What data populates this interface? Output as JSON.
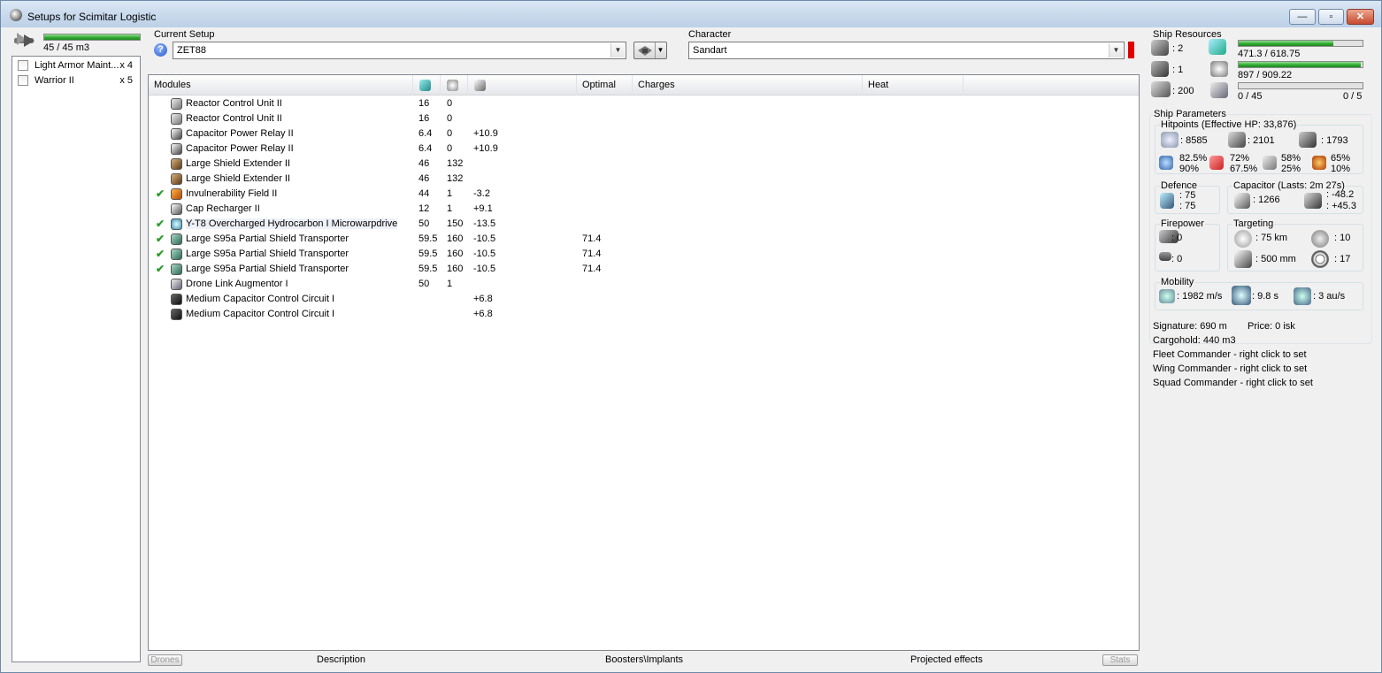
{
  "window": {
    "title": "Setups for Scimitar Logistic",
    "minimize": "—",
    "maximize": "▫",
    "close": "✕"
  },
  "drone_bay": {
    "capacity_text": "45 / 45 m3",
    "capacity_fraction": 1.0,
    "items": [
      {
        "label": "Light Armor Maint...",
        "count": "x 4"
      },
      {
        "label": "Warrior II",
        "count": "x 5"
      }
    ]
  },
  "setup": {
    "group_label": "Current Setup",
    "selected": "ZET88",
    "help_icon": "question-icon"
  },
  "character": {
    "group_label": "Character",
    "selected": "Sandart"
  },
  "modules": {
    "headers": {
      "modules": "Modules",
      "cpu_icon": "cpu-icon",
      "power_icon": "powergrid-icon",
      "cap_icon": "capacitor-icon",
      "optimal": "Optimal",
      "charges": "Charges",
      "heat": "Heat"
    },
    "rows": [
      {
        "active": false,
        "icon": "reactor-icon",
        "name": "Reactor Control Unit II",
        "cpu": "16",
        "pg": "0",
        "cap": "",
        "optimal": ""
      },
      {
        "active": false,
        "icon": "reactor-icon",
        "name": "Reactor Control Unit II",
        "cpu": "16",
        "pg": "0",
        "cap": "",
        "optimal": ""
      },
      {
        "active": false,
        "icon": "cap-relay-icon",
        "name": "Capacitor Power Relay II",
        "cpu": "6.4",
        "pg": "0",
        "cap": "+10.9",
        "optimal": ""
      },
      {
        "active": false,
        "icon": "cap-relay-icon",
        "name": "Capacitor Power Relay II",
        "cpu": "6.4",
        "pg": "0",
        "cap": "+10.9",
        "optimal": ""
      },
      {
        "active": false,
        "icon": "shield-extender-icon",
        "name": "Large Shield Extender II",
        "cpu": "46",
        "pg": "132",
        "cap": "",
        "optimal": ""
      },
      {
        "active": false,
        "icon": "shield-extender-icon",
        "name": "Large Shield Extender II",
        "cpu": "46",
        "pg": "132",
        "cap": "",
        "optimal": ""
      },
      {
        "active": true,
        "icon": "invuln-field-icon",
        "name": "Invulnerability Field II",
        "cpu": "44",
        "pg": "1",
        "cap": "-3.2",
        "optimal": ""
      },
      {
        "active": false,
        "icon": "cap-recharger-icon",
        "name": "Cap Recharger II",
        "cpu": "12",
        "pg": "1",
        "cap": "+9.1",
        "optimal": ""
      },
      {
        "active": true,
        "icon": "microwarpdrive-icon",
        "name": "Y-T8 Overcharged Hydrocarbon I Microwarpdrive",
        "cpu": "50",
        "pg": "150",
        "cap": "-13.5",
        "optimal": ""
      },
      {
        "active": true,
        "icon": "shield-transporter-icon",
        "name": "Large S95a Partial Shield Transporter",
        "cpu": "59.5",
        "pg": "160",
        "cap": "-10.5",
        "optimal": "71.4"
      },
      {
        "active": true,
        "icon": "shield-transporter-icon",
        "name": "Large S95a Partial Shield Transporter",
        "cpu": "59.5",
        "pg": "160",
        "cap": "-10.5",
        "optimal": "71.4"
      },
      {
        "active": true,
        "icon": "shield-transporter-icon",
        "name": "Large S95a Partial Shield Transporter",
        "cpu": "59.5",
        "pg": "160",
        "cap": "-10.5",
        "optimal": "71.4"
      },
      {
        "active": false,
        "icon": "drone-link-icon",
        "name": "Drone Link Augmentor I",
        "cpu": "50",
        "pg": "1",
        "cap": "",
        "optimal": ""
      },
      {
        "active": false,
        "icon": "rig-icon",
        "name": "Medium Capacitor Control Circuit I",
        "cpu": "",
        "pg": "",
        "cap": "+6.8",
        "optimal": ""
      },
      {
        "active": false,
        "icon": "rig-icon",
        "name": "Medium Capacitor Control Circuit I",
        "cpu": "",
        "pg": "",
        "cap": "+6.8",
        "optimal": ""
      }
    ],
    "check_glyph": "✔"
  },
  "bottom_tabs": {
    "drones": "Drones",
    "description": "Description",
    "boosters": "Boosters\\Implants",
    "projected": "Projected effects",
    "stats": "Stats"
  },
  "ship_resources": {
    "label": "Ship Resources",
    "turret_slots": ": 2",
    "launcher_slots": ": 1",
    "calibration": ": 200",
    "cpu_text": "471.3 / 618.75",
    "cpu_fraction": 0.762,
    "power_text": "897 / 909.22",
    "power_fraction": 0.987,
    "drone_bandwidth_text": "0 / 45",
    "drone_count_text": "0 / 5",
    "drone_fraction": 0.0
  },
  "ship_parameters": {
    "label": "Ship Parameters",
    "hitpoints_label": "Hitpoints (Effective HP: 33,876)",
    "shield_hp": ": 8585",
    "armor_hp": ": 2101",
    "structure_hp": ": 1793",
    "resists": [
      {
        "icon": "em-resist-icon",
        "shield": "82.5%",
        "armor": "90%"
      },
      {
        "icon": "thermal-resist-icon",
        "shield": "72%",
        "armor": "67.5%"
      },
      {
        "icon": "kinetic-resist-icon",
        "shield": "58%",
        "armor": "25%"
      },
      {
        "icon": "explosive-resist-icon",
        "shield": "65%",
        "armor": "10%"
      }
    ],
    "defence_label": "Defence",
    "defence_a": ": 75",
    "defence_b": ": 75",
    "capacitor_label": "Capacitor (Lasts: 2m 27s)",
    "capacitor_amount": ": 1266",
    "cap_use": ": -48.2",
    "cap_regen": ": +45.3",
    "firepower_label": "Firepower",
    "firepower_turrets": ": 0",
    "firepower_drones": ": 0",
    "targeting_label": "Targeting",
    "targeting_range": ": 75 km",
    "max_targets": ": 10",
    "scan_res": ": 500 mm",
    "sensor_strength": ": 17",
    "mobility_label": "Mobility",
    "max_velocity": ": 1982 m/s",
    "align_time": ": 9.8 s",
    "warp_speed": ": 3 au/s"
  },
  "summary": {
    "signature": "Signature: 690 m",
    "price": "Price: 0 isk",
    "cargohold": "Cargohold: 440 m3",
    "fleet_commander": "Fleet Commander - right click to set",
    "wing_commander": "Wing Commander - right click to set",
    "squad_commander": "Squad Commander - right click to set"
  },
  "colors": {
    "bar_green": "#2fa62f",
    "check_green": "#2e9b2e",
    "red_marker": "#e00000"
  }
}
